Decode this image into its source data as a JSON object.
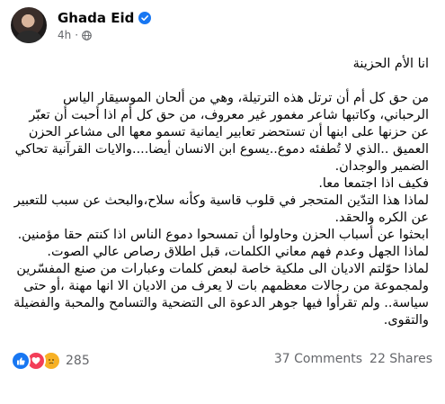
{
  "post": {
    "author": "Ghada Eid",
    "time": "4h",
    "privacy_icon": "globe-icon",
    "verified_icon": "verified-badge-icon",
    "paragraphs": [
      "انا الأم الحزينة",
      "",
      "من حق كل أم أن ترتل هذه الترتيلة، وهي من ألحان الموسيقار الياس الرحباني، وكاتبها شاعر مغمور غير معروف، من حق كل أم اذا أحبت أن تعبّر عن حزنها على ابنها أن تستحضر تعابير ايمانية تسمو معها الى مشاعر الحزن العميق ..الذي لا تُطفئه دموع..يسوع ابن الانسان أيضا....والايات القرآنية تحاكي الضمير والوجدان.",
      "فكيف اذا اجتمعا معا.",
      "لماذا هذا التدّين المتحجر في قلوب قاسية وكأنه سلاح،والبحث عن سبب للتعبير عن الكره والحقد.",
      "ابحثوا عن أسباب الحزن وحاولوا أن تمسحوا دموع الناس اذا كنتم حقا مؤمنين.",
      "لماذا الجهل وعدم فهم معاني الكلمات، قبل اطلاق رصاص عالي الصوت.",
      "لماذا حوّلتم الاديان الى ملكية خاصة لبعض كلمات وعبارات من صنع المفسّرين ولمجموعة من رجالات معظمهم بات لا يعرف من الاديان الا انها مهنة ،أو حتى سياسة.. ولم تقرأوا فيها جوهر الدعوة الى التضحية والتسامح والمحبة والفضيلة والتقوى."
    ]
  },
  "engagement": {
    "reaction_icons": [
      "like-reaction-icon",
      "love-reaction-icon",
      "sad-reaction-icon"
    ],
    "reaction_count": "285",
    "comments": "37 Comments",
    "shares": "22 Shares"
  },
  "colors": {
    "text": "#050505",
    "secondary": "#65676b",
    "brand_blue": "#1877f2",
    "love_red": "#f33e58",
    "sad_yellow": "#f7b125"
  }
}
